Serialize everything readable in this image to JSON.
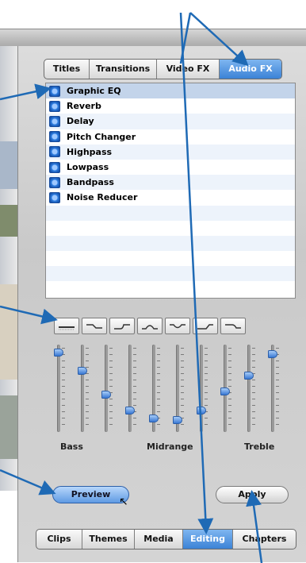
{
  "tabs": [
    {
      "label": "Titles",
      "active": false
    },
    {
      "label": "Transitions",
      "active": false
    },
    {
      "label": "Video FX",
      "active": false
    },
    {
      "label": "Audio FX",
      "active": true
    }
  ],
  "effects": [
    {
      "label": "Graphic EQ",
      "selected": true
    },
    {
      "label": "Reverb",
      "selected": false
    },
    {
      "label": "Delay",
      "selected": false
    },
    {
      "label": "Pitch Changer",
      "selected": false
    },
    {
      "label": "Highpass",
      "selected": false
    },
    {
      "label": "Lowpass",
      "selected": false
    },
    {
      "label": "Bandpass",
      "selected": false
    },
    {
      "label": "Noise Reducer",
      "selected": false
    }
  ],
  "eq": {
    "band_labels": {
      "bass": "Bass",
      "midrange": "Midrange",
      "treble": "Treble"
    },
    "slider_levels": [
      0.95,
      0.72,
      0.42,
      0.22,
      0.12,
      0.1,
      0.22,
      0.46,
      0.66,
      0.93
    ]
  },
  "buttons": {
    "preview": "Preview",
    "apply": "Apply"
  },
  "bottom_nav": [
    {
      "label": "Clips",
      "active": false
    },
    {
      "label": "Themes",
      "active": false
    },
    {
      "label": "Media",
      "active": false
    },
    {
      "label": "Editing",
      "active": true
    },
    {
      "label": "Chapters",
      "active": false
    }
  ],
  "colors": {
    "accent": "#3b82d6",
    "annotation": "#1f6ab5",
    "list_alt_row": "#edf3fb"
  }
}
